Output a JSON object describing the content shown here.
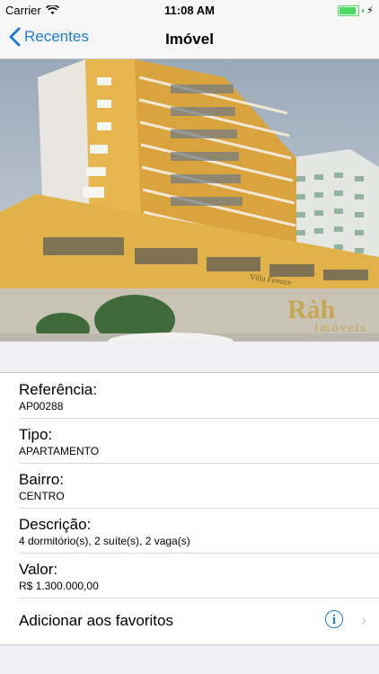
{
  "status_bar": {
    "carrier": "Carrier",
    "time": "11:08 AM",
    "battery_level": 1.0
  },
  "nav": {
    "back_label": "Recentes",
    "title": "Imóvel"
  },
  "hero": {
    "watermark_brand": "Ràh",
    "watermark_sub": "Imóveis",
    "building_sign": "Villa Firenze"
  },
  "details": [
    {
      "label": "Referência:",
      "value": "AP00288"
    },
    {
      "label": "Tipo:",
      "value": "APARTAMENTO"
    },
    {
      "label": "Bairro:",
      "value": "CENTRO"
    },
    {
      "label": "Descrição:",
      "value": "4 dormitório(s), 2 suíte(s), 2 vaga(s)"
    },
    {
      "label": "Valor:",
      "value": "R$ 1.300.000,00"
    }
  ],
  "favorites": {
    "label": "Adicionar aos favoritos",
    "info_icon": "info-icon",
    "chevron_icon": "chevron-right-icon"
  },
  "colors": {
    "accent": "#1f7bdb",
    "battery": "#4cd964",
    "background": "#efeff4"
  }
}
